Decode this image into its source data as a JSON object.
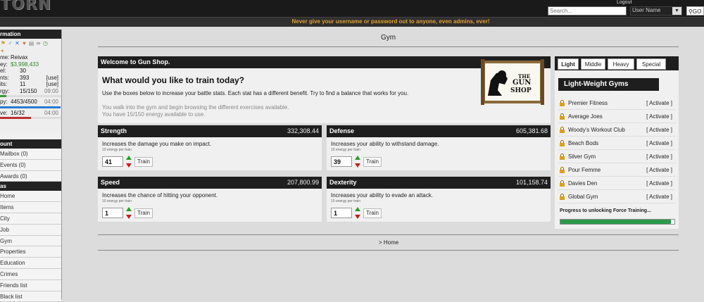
{
  "header": {
    "logo": "TORN",
    "logout": "Logout",
    "search_placeholder": "Search...",
    "search_type": "User Name",
    "go": "GO"
  },
  "warning": "Never give your username or password out to anyone, even admins, ever!",
  "sidebar": {
    "info_heading": "rmation",
    "icons": [
      "flag-icon",
      "gender-icon",
      "crossed-swords-icon",
      "heart-icon",
      "briefcase-icon",
      "link-icon",
      "clock-icon"
    ],
    "stats": [
      {
        "label": "me:",
        "value": "Reivax"
      },
      {
        "label": "ey:",
        "value": "$3,998,433"
      },
      {
        "label": "el:",
        "value": "30"
      },
      {
        "label": "nts:",
        "value": "393",
        "extra": "[use]"
      },
      {
        "label": "its:",
        "value": "11",
        "extra": "[use]"
      },
      {
        "label": "rgy:",
        "value": "15/150",
        "extra": "09:00"
      },
      {
        "label": "py:",
        "value": "4453/4500",
        "extra": "04:00"
      },
      {
        "label": "ve:",
        "value": "16/32",
        "extra": "04:00"
      }
    ],
    "energy_fraction": 0.1,
    "happy_fraction": 0.99,
    "nerve_fraction": 0.5,
    "account_heading": "ount",
    "account_items": [
      "Mailbox (0)",
      "Events (0)",
      "Awards (0)"
    ],
    "areas_heading": "as",
    "area_items": [
      "Home",
      "Items",
      "City",
      "Job",
      "Gym",
      "Properties",
      "Education",
      "Crimes",
      "Friends list",
      "Black list"
    ]
  },
  "page_title": "Gym",
  "welcome": {
    "heading": "Welcome to Gun Shop.",
    "question": "What would you like to train today?",
    "intro": "Use the boxes below to increase your battle stats. Each stat has a different benefit. Try to find a balance that works for you.",
    "walk": "You walk into the gym and begin browsing the different exercises available.",
    "energy": "You have 15/150 energy available to use.",
    "sign_line1": "THE",
    "sign_line2": "GUN",
    "sign_line3": "SHOP"
  },
  "stats": [
    {
      "name": "Strength",
      "value": "332,308.44",
      "desc": "Increases the damage you make on impact.",
      "cost": "10 energy per train",
      "qty": "41",
      "train": "Train"
    },
    {
      "name": "Defense",
      "value": "605,381.68",
      "desc": "Increases your ability to withstand damage.",
      "cost": "10 energy per train",
      "qty": "39",
      "train": "Train"
    },
    {
      "name": "Speed",
      "value": "207,800.99",
      "desc": "Increases the chance of hitting your opponent.",
      "cost": "10 energy per train",
      "qty": "1",
      "train": "Train"
    },
    {
      "name": "Dexterity",
      "value": "101,158.74",
      "desc": "Increases your ability to evade an attack.",
      "cost": "10 energy per train",
      "qty": "1",
      "train": "Train"
    }
  ],
  "gyms_panel": {
    "tabs": [
      "Light",
      "Middle",
      "Heavy",
      "Special"
    ],
    "active_tab": "Light",
    "title": "Light-Weight Gyms",
    "gyms": [
      {
        "name": "Premier Fitness",
        "action": "[ Activate ]"
      },
      {
        "name": "Average Joes",
        "action": "[ Activate ]"
      },
      {
        "name": "Woody's Workout Club",
        "action": "[ Activate ]"
      },
      {
        "name": "Beach Bods",
        "action": "[ Activate ]"
      },
      {
        "name": "Silver Gym",
        "action": "[ Activate ]"
      },
      {
        "name": "Pour Femme",
        "action": "[ Activate ]"
      },
      {
        "name": "Davies Den",
        "action": "[ Activate ]"
      },
      {
        "name": "Global Gym",
        "action": "[ Activate ]"
      }
    ],
    "progress_label": "Progress to unlocking Force Training...",
    "progress_fraction": 0.97
  },
  "footer_link": "> Home",
  "colors": {
    "warning": "#e0a030",
    "money": "#2a8a2a",
    "progress": "#2a9a4a",
    "lock": "#d9a020"
  }
}
